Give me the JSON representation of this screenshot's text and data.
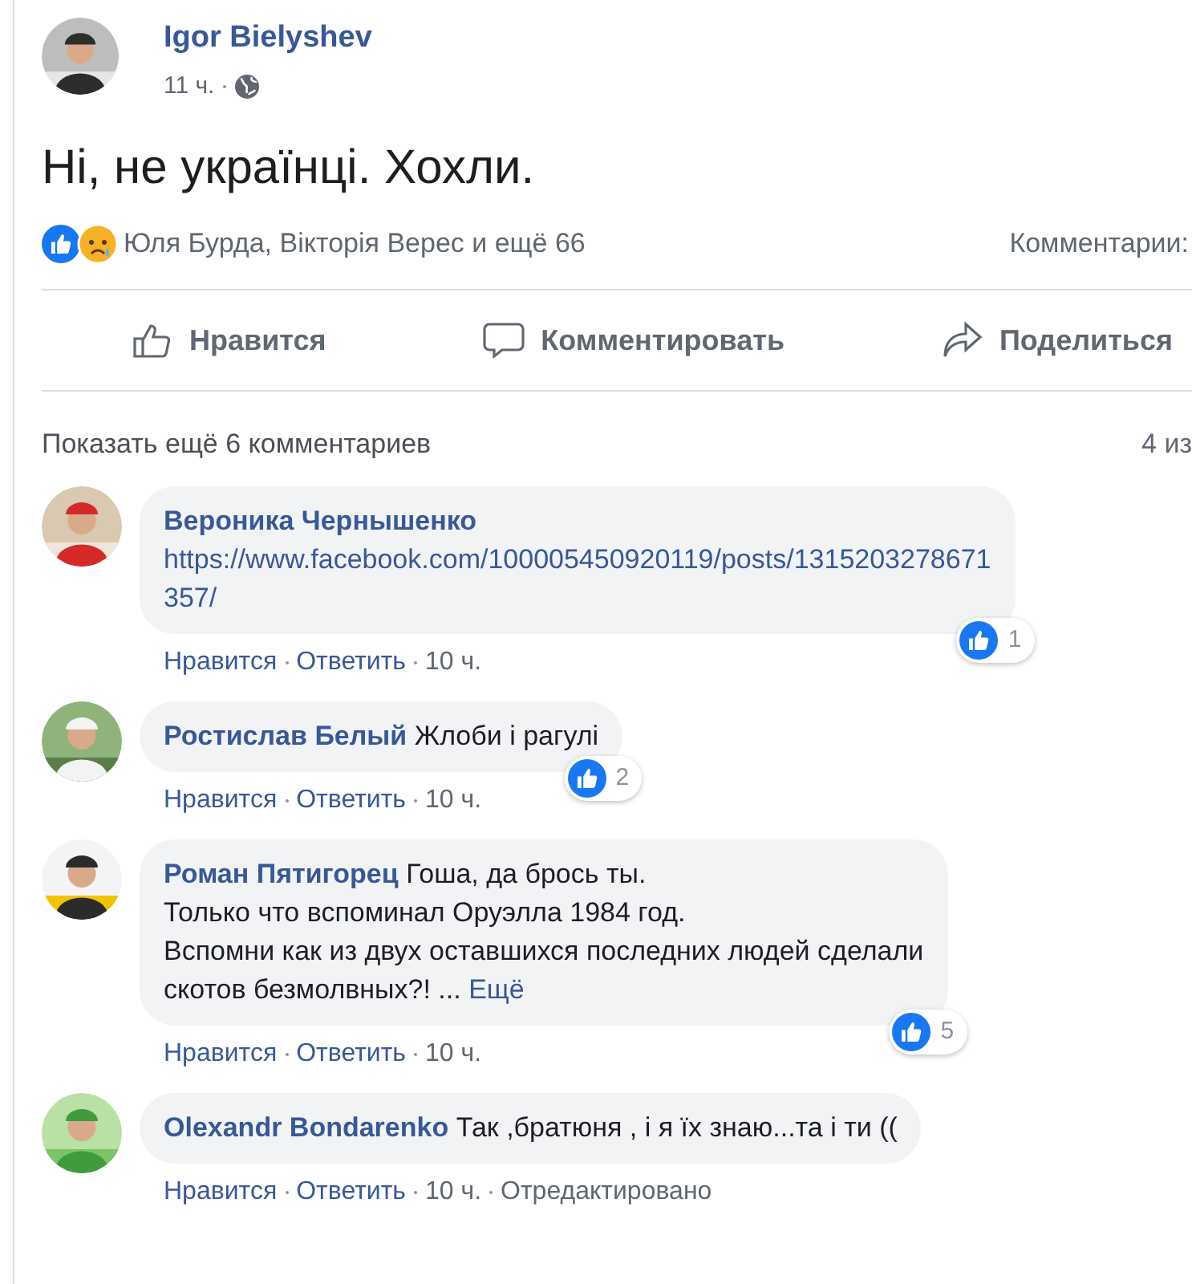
{
  "post": {
    "author": "Igor Bielyshev",
    "time": "11 ч.",
    "text": "Ні, не українці. Хохли.",
    "reactions": {
      "names": "Юля Бурда, Вікторія Верес и ещё 66",
      "comments_label": "Комментарии:"
    },
    "actions": [
      {
        "kind": "like",
        "label": "Нравится"
      },
      {
        "kind": "comment",
        "label": "Комментировать"
      },
      {
        "kind": "share",
        "label": "Поделиться"
      }
    ]
  },
  "comments_bar": {
    "show_more": "Показать ещё 6 комментариев",
    "count": "4 из"
  },
  "comments": [
    {
      "author": "Вероника Чернышенко",
      "kind": "link",
      "lines": [
        "https://www.facebook.com/100005450920119/posts/1315203278671",
        "357/"
      ],
      "likes": "1",
      "actions": [
        "Нравится",
        "Ответить",
        "10 ч."
      ]
    },
    {
      "author": "Ростислав Белый",
      "kind": "text",
      "lines": [
        "Жлоби і рагулі"
      ],
      "likes": "2",
      "actions": [
        "Нравится",
        "Ответить",
        "10 ч."
      ]
    },
    {
      "author": "Роман Пятигорец",
      "kind": "text",
      "lines": [
        "Гоша, да брось ты.",
        "Только что вспоминал Оруэлла 1984 год.",
        "Вспомни как из двух оставшихся последних людей сделали",
        "скотов безмолвных?! ..."
      ],
      "more": "Ещё",
      "likes": "5",
      "actions": [
        "Нравится",
        "Ответить",
        "10 ч."
      ]
    },
    {
      "author": "Olexandr Bondarenko",
      "kind": "text",
      "lines": [
        "Так ,братюня , і я їх знаю...та і ти (("
      ],
      "actions": [
        "Нравится",
        "Ответить",
        "10 ч.",
        "Отредактировано"
      ]
    }
  ]
}
